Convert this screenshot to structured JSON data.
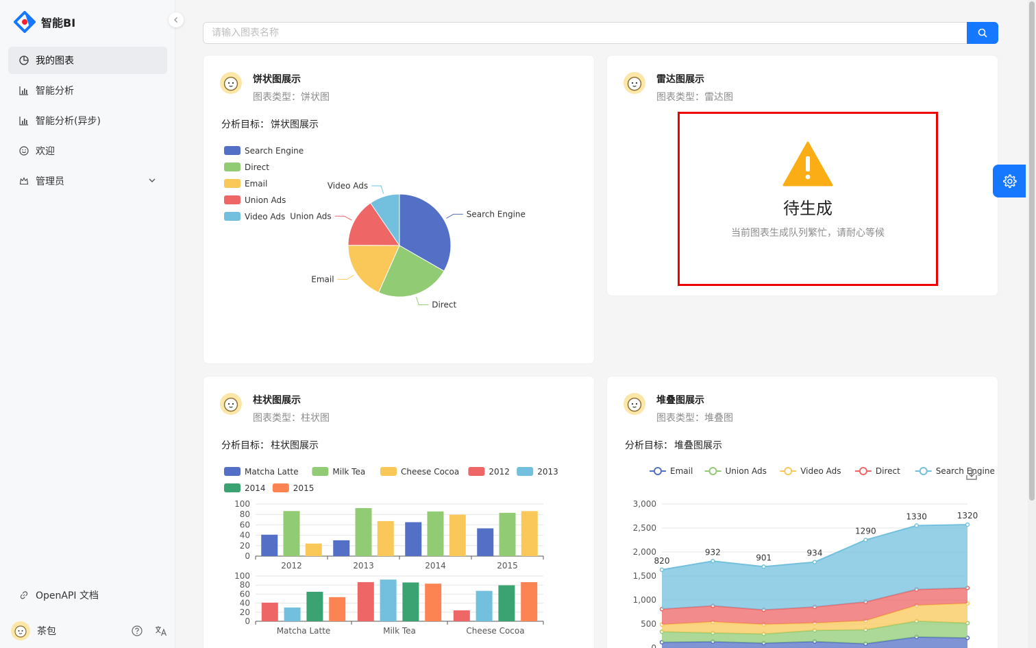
{
  "app": {
    "title": "智能BI"
  },
  "sidebar": {
    "items": [
      {
        "label": "我的图表",
        "icon": "pie-chart-icon",
        "active": true
      },
      {
        "label": "智能分析",
        "icon": "bar-chart-icon"
      },
      {
        "label": "智能分析(异步)",
        "icon": "bar-chart-icon"
      },
      {
        "label": "欢迎",
        "icon": "smile-icon"
      },
      {
        "label": "管理员",
        "icon": "crown-icon"
      }
    ],
    "openapi": "OpenAPI 文档",
    "user": "茶包"
  },
  "search": {
    "placeholder": "请输入图表名称"
  },
  "cards": [
    {
      "title": "饼状图展示",
      "type": "图表类型：饼状图",
      "goal_label": "分析目标：",
      "goal": "饼状图展示"
    },
    {
      "title": "雷达图展示",
      "type": "图表类型：雷达图",
      "pending_title": "待生成",
      "pending_sub": "当前图表生成队列繁忙，请耐心等候"
    },
    {
      "title": "柱状图展示",
      "type": "图表类型：柱状图",
      "goal_label": "分析目标：",
      "goal": "柱状图展示"
    },
    {
      "title": "堆叠图展示",
      "type": "图表类型：堆叠图",
      "goal_label": "分析目标：",
      "goal": "堆叠图展示"
    }
  ],
  "colors": {
    "primary": "#1677ff",
    "warning": "#faad14",
    "highlight": "#e00000"
  },
  "chart_data": [
    {
      "type": "pie",
      "legend": [
        "Search Engine",
        "Direct",
        "Email",
        "Union Ads",
        "Video Ads"
      ],
      "values": [
        1048,
        735,
        580,
        484,
        300
      ],
      "colors": [
        "#5470c6",
        "#91cc75",
        "#fac858",
        "#ee6666",
        "#73c0de"
      ],
      "legend_position": "top-left"
    },
    {
      "type": "bar",
      "legend": [
        "Matcha Latte",
        "Milk Tea",
        "Cheese Cocoa",
        "2012",
        "2013",
        "2014",
        "2015"
      ],
      "legend_colors": [
        "#5470c6",
        "#91cc75",
        "#fac858",
        "#ee6666",
        "#73c0de",
        "#3ba272",
        "#fc8452"
      ],
      "top": {
        "categories": [
          "2012",
          "2013",
          "2014",
          "2015"
        ],
        "series": [
          {
            "name": "Matcha Latte",
            "values": [
              41.1,
              30.4,
              65.1,
              53.3
            ]
          },
          {
            "name": "Milk Tea",
            "values": [
              86.5,
              92.1,
              85.7,
              83.1
            ]
          },
          {
            "name": "Cheese Cocoa",
            "values": [
              24.1,
              67.2,
              79.5,
              86.4
            ]
          }
        ],
        "yticks": [
          "100",
          "80",
          "60",
          "40",
          "20",
          "0"
        ],
        "ylim": [
          0,
          100
        ]
      },
      "bottom": {
        "categories": [
          "Matcha Latte",
          "Milk Tea",
          "Cheese Cocoa"
        ],
        "series": [
          {
            "name": "2012",
            "values": [
              41.1,
              86.5,
              24.1
            ]
          },
          {
            "name": "2013",
            "values": [
              30.4,
              92.1,
              67.2
            ]
          },
          {
            "name": "2014",
            "values": [
              65.1,
              85.7,
              79.5
            ]
          },
          {
            "name": "2015",
            "values": [
              53.3,
              83.1,
              86.4
            ]
          }
        ],
        "yticks": [
          "100",
          "80",
          "60",
          "40",
          "20",
          "0"
        ],
        "ylim": [
          0,
          100
        ]
      }
    },
    {
      "type": "area",
      "stacked": true,
      "legend": [
        "Email",
        "Union Ads",
        "Video Ads",
        "Direct",
        "Search Engine"
      ],
      "legend_colors": [
        "#5470c6",
        "#91cc75",
        "#fac858",
        "#ee6666",
        "#73c0de"
      ],
      "series": [
        {
          "name": "Email",
          "values": [
            120,
            132,
            101,
            134,
            90,
            230,
            210
          ]
        },
        {
          "name": "Union Ads",
          "values": [
            220,
            182,
            191,
            234,
            290,
            330,
            310
          ]
        },
        {
          "name": "Video Ads",
          "values": [
            150,
            232,
            201,
            154,
            190,
            330,
            410
          ]
        },
        {
          "name": "Direct",
          "values": [
            320,
            332,
            301,
            334,
            390,
            330,
            320
          ]
        },
        {
          "name": "Search Engine",
          "values": [
            820,
            932,
            901,
            934,
            1290,
            1330,
            1320
          ]
        }
      ],
      "labels": [
        "820",
        "932",
        "901",
        "934",
        "1290",
        "1330",
        "1320"
      ],
      "yticks": [
        "3,000",
        "2,500",
        "2,000",
        "1,500",
        "1,000",
        "500",
        "0"
      ],
      "ylim": [
        0,
        3000
      ]
    }
  ]
}
